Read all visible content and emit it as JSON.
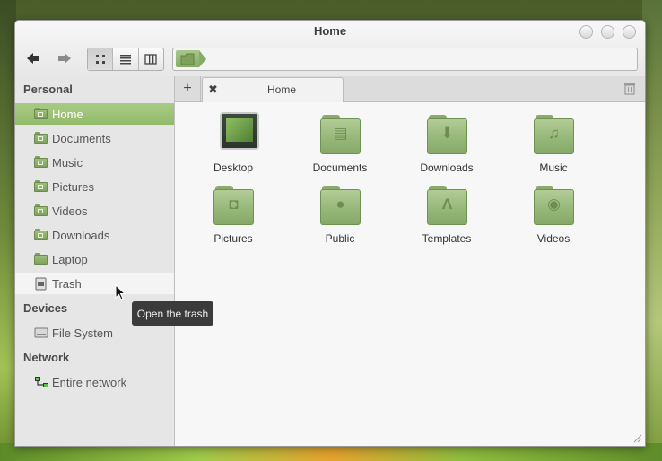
{
  "window": {
    "title": "Home"
  },
  "toolbar": {
    "back_icon": "back-arrow-icon",
    "forward_icon": "forward-arrow-icon",
    "views": [
      "icon-view",
      "list-view",
      "column-view"
    ],
    "location_icon": "home-folder-icon"
  },
  "sidebar": {
    "sections": [
      {
        "label": "Personal"
      },
      {
        "label": "Devices"
      },
      {
        "label": "Network"
      }
    ],
    "items": [
      {
        "label": "Home",
        "icon": "home-folder-icon"
      },
      {
        "label": "Documents",
        "icon": "documents-folder-icon"
      },
      {
        "label": "Music",
        "icon": "music-folder-icon"
      },
      {
        "label": "Pictures",
        "icon": "pictures-folder-icon"
      },
      {
        "label": "Videos",
        "icon": "videos-folder-icon"
      },
      {
        "label": "Downloads",
        "icon": "downloads-folder-icon"
      },
      {
        "label": "Laptop",
        "icon": "folder-icon"
      },
      {
        "label": "Trash",
        "icon": "trash-icon"
      },
      {
        "label": "File System",
        "icon": "harddisk-icon"
      },
      {
        "label": "Entire network",
        "icon": "network-icon"
      }
    ]
  },
  "tabs": {
    "add_label": "+",
    "close_label": "✖",
    "active_label": "Home"
  },
  "files": [
    {
      "label": "Desktop",
      "icon": "desktop-icon"
    },
    {
      "label": "Documents",
      "icon": "documents-folder-icon"
    },
    {
      "label": "Downloads",
      "icon": "downloads-folder-icon"
    },
    {
      "label": "Music",
      "icon": "music-folder-icon"
    },
    {
      "label": "Pictures",
      "icon": "pictures-folder-icon"
    },
    {
      "label": "Public",
      "icon": "public-folder-icon"
    },
    {
      "label": "Templates",
      "icon": "templates-folder-icon"
    },
    {
      "label": "Videos",
      "icon": "videos-folder-icon"
    }
  ],
  "tooltip": {
    "text": "Open the trash"
  },
  "colors": {
    "accent": "#9dc57a",
    "folder": "#98b97a",
    "tooltip_bg": "#3b3b3b"
  }
}
